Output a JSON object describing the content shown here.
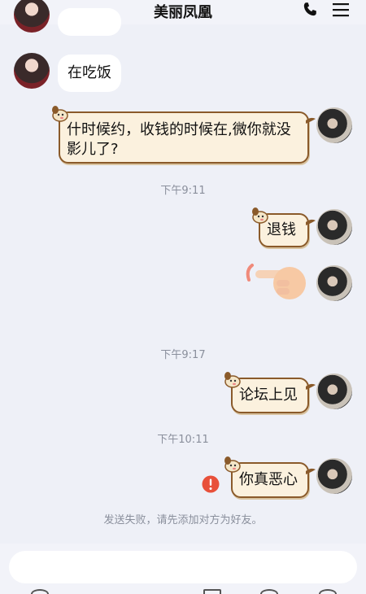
{
  "header": {
    "title": "美丽凤凰"
  },
  "messages": [
    {
      "side": "left",
      "text": "在吃饭"
    },
    {
      "side": "right",
      "lines": [
        "什时候约，收钱的时候在,微你就没",
        "影儿了?"
      ]
    },
    {
      "time": "下午9:11"
    },
    {
      "side": "right",
      "text": "退钱"
    },
    {
      "side": "right",
      "type": "gesture",
      "icon": "pointing-hand-icon"
    },
    {
      "time": "下午9:17"
    },
    {
      "side": "right",
      "text": "论坛上见"
    },
    {
      "time": "下午10:11"
    },
    {
      "side": "right",
      "text": "你真恶心",
      "status": "failed"
    }
  ],
  "status_hint": "发送失败，请先添加对方为好友。",
  "input": {
    "placeholder": ""
  },
  "colors": {
    "background": "#eef0f7",
    "bubble_left": "#ffffff",
    "bubble_deco": "#fbf1de",
    "deco_border": "#8a5a2a",
    "error": "#e8503a"
  }
}
